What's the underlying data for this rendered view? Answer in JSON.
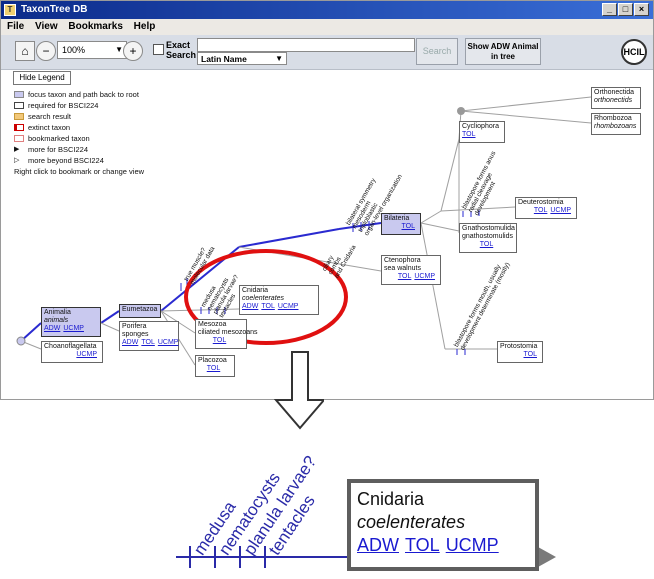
{
  "window": {
    "title": "TaxonTree DB",
    "controls": [
      "_",
      "□",
      "×"
    ]
  },
  "menu": [
    "File",
    "View",
    "Bookmarks",
    "Help"
  ],
  "toolbar": {
    "zoom_value": "100%",
    "exact_label_1": "Exact",
    "exact_label_2": "Search",
    "search_field": "Latin Name",
    "search_button": "Search",
    "show_button_line1": "Show ADW Animal",
    "show_button_line2": "in tree",
    "logo_text": "HCIL"
  },
  "legend": {
    "hide_button": "Hide Legend",
    "items": [
      {
        "label": "focus taxon and path back to root",
        "color": "#c9c9ef",
        "border": "#888888"
      },
      {
        "label": "required for BSCI224",
        "color": "#ffffff",
        "border": "#444444"
      },
      {
        "label": "search result",
        "color": "#f2c87a",
        "border": "#c89a3a"
      },
      {
        "label": "extinct taxon",
        "color": "#ffffff",
        "border": "#cc0000"
      },
      {
        "label": "bookmarked taxon",
        "color": "#ffffff",
        "border": "#e08080"
      },
      {
        "label": "more for BSCI224",
        "arrow": "▶"
      },
      {
        "label": "more beyond BSCI224",
        "arrow": "▷"
      }
    ],
    "note": "Right click to bookmark or change view"
  },
  "tree": {
    "animalia": {
      "name": "Animalia",
      "common": "animals",
      "links": [
        "ADW",
        "UCMP"
      ]
    },
    "choanoflagellata": {
      "name": "Choanoflagellata",
      "links": [
        "UCMP"
      ]
    },
    "eumetazoa": {
      "name": "Eumetazoa"
    },
    "porifera": {
      "name": "Porifera",
      "common": "sponges",
      "links": [
        "ADW",
        "TOL",
        "UCMP"
      ]
    },
    "cnidaria": {
      "name": "Cnidaria",
      "common": "coelenterates",
      "links": [
        "ADW",
        "TOL",
        "UCMP"
      ]
    },
    "mesozoa": {
      "name": "Mesozoa",
      "common": "ciliated mesozoans",
      "links": [
        "TOL"
      ]
    },
    "placozoa": {
      "name": "Placozoa",
      "links": [
        "TOL"
      ]
    },
    "bilateria": {
      "name": "Bilateria",
      "links": [
        "TOL"
      ]
    },
    "ctenophora": {
      "name": "Ctenophora",
      "common": "sea walnuts",
      "links": [
        "TOL",
        "UCMP"
      ]
    },
    "cycliophora": {
      "name": "Cycliophora",
      "links": [
        "TOL"
      ]
    },
    "orthonectida": {
      "name": "Orthonectida",
      "common": "orthonectids"
    },
    "rhombozoa": {
      "name": "Rhombozoa",
      "common": "rhombozoans"
    },
    "deuterostomia": {
      "name": "Deuterostomia",
      "links": [
        "TOL",
        "UCMP"
      ]
    },
    "gnathostomulida": {
      "name": "Gnathostomulida",
      "common": "gnathostomulids",
      "links": [
        "TOL"
      ]
    },
    "protostomia": {
      "name": "Protostomia",
      "links": [
        "TOL"
      ]
    },
    "traits_eumetazoa": [
      "true muscle?",
      "molecular data"
    ],
    "traits_cnidaria": [
      "medusa",
      "nematocysts",
      "planula larvae?",
      "tentacles"
    ],
    "traits_bilateria": [
      "bilateral symmetry",
      "mesoderm",
      "triploblastic",
      "organ-level organization"
    ],
    "traits_ctenophora": [
      "ciliary",
      "combs",
      "and Cnidaria"
    ],
    "traits_deutero": [
      "blastopore forms anus",
      "radial cleavage",
      "development"
    ],
    "traits_proto": [
      "blastopore forms mouth, usually",
      "development determinate (mostly)"
    ]
  },
  "zoom": {
    "labels": [
      "medusa",
      "nematocysts",
      "planula larvae?",
      "tentacles"
    ],
    "node": {
      "name": "Cnidaria",
      "common": "coelenterates",
      "links": [
        "ADW",
        "TOL",
        "UCMP"
      ]
    }
  }
}
